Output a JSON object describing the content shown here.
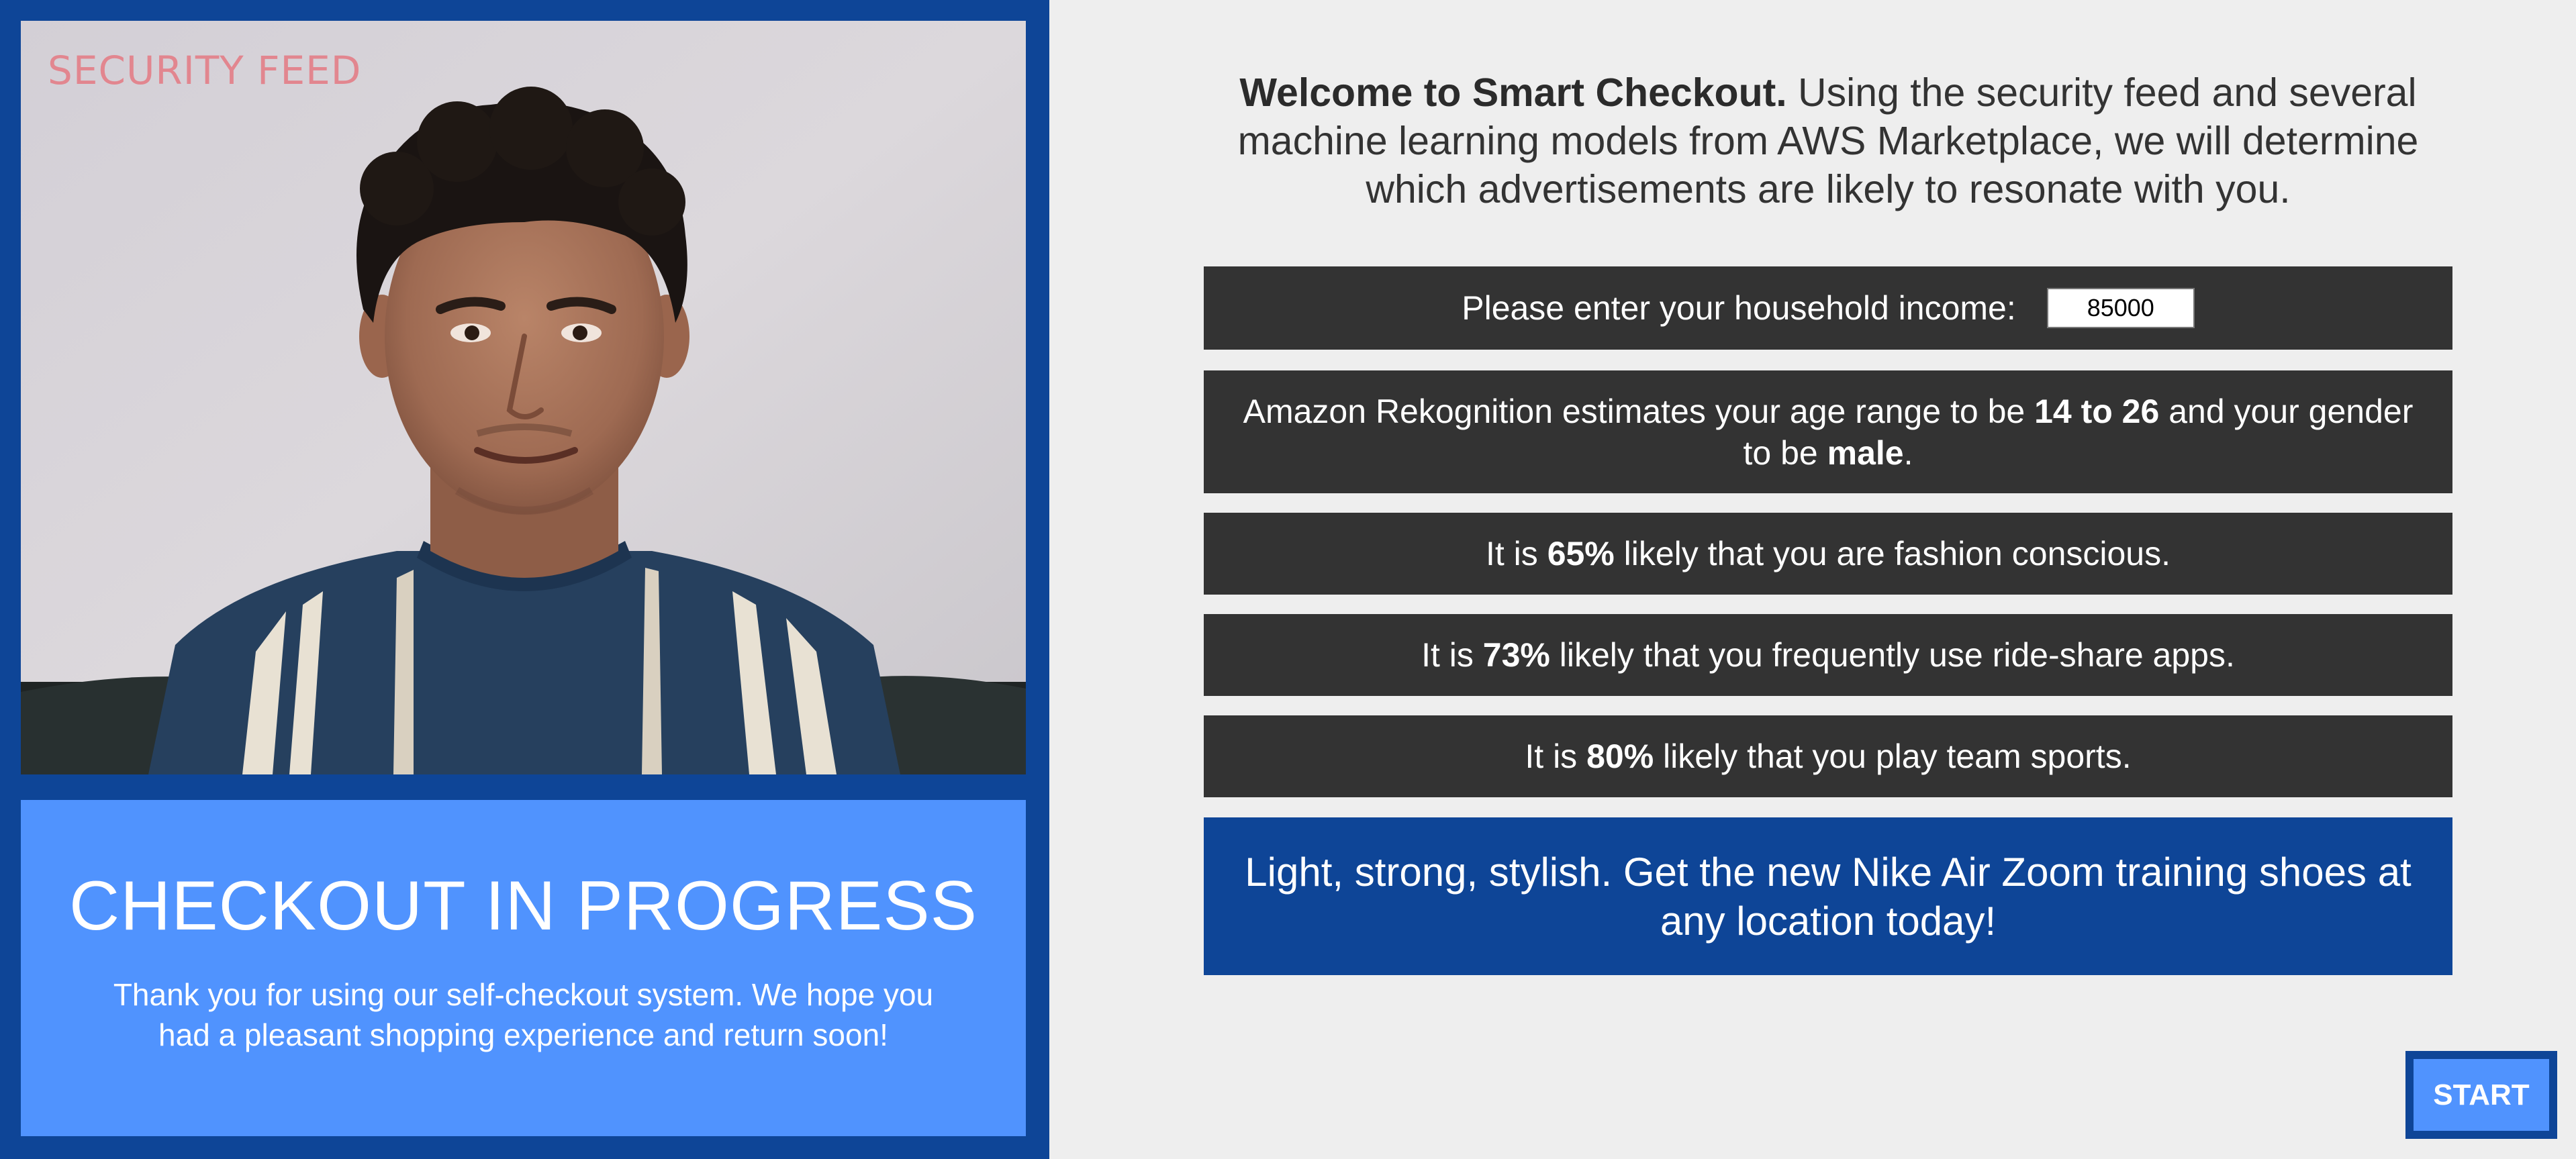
{
  "security_feed": {
    "label": "SECURITY FEED"
  },
  "checkout_status": {
    "title": "CHECKOUT IN PROGRESS",
    "message": "Thank you for using our self-checkout system. We hope you had a pleasant shopping experience and return soon!"
  },
  "welcome": {
    "heading": "Welcome to Smart Checkout.",
    "text": " Using the security feed and several machine learning models from AWS Marketplace, we will determine which advertisements are likely to resonate with you."
  },
  "income": {
    "label": "Please enter your household income:",
    "value": "85000"
  },
  "rekognition": {
    "prefix": "Amazon Rekognition estimates your age range to be ",
    "age_range": "14 to 26",
    "middle": " and your gender to be ",
    "gender": "male",
    "suffix": "."
  },
  "predictions": [
    {
      "prefix": "It is ",
      "percent": "65%",
      "suffix": " likely that you are fashion conscious."
    },
    {
      "prefix": "It is ",
      "percent": "73%",
      "suffix": " likely that you frequently use ride-share apps."
    },
    {
      "prefix": "It is ",
      "percent": "80%",
      "suffix": " likely that you play team sports."
    }
  ],
  "advertisement": {
    "text": "Light, strong, stylish. Get the new Nike Air Zoom training shoes at any location today!"
  },
  "start_button": {
    "label": "START"
  },
  "colors": {
    "brand_dark_blue": "#0e4597",
    "brand_light_blue": "#5093fe",
    "panel_gray": "#eeeeee",
    "info_box": "#333333",
    "feed_label": "#e2868f"
  }
}
